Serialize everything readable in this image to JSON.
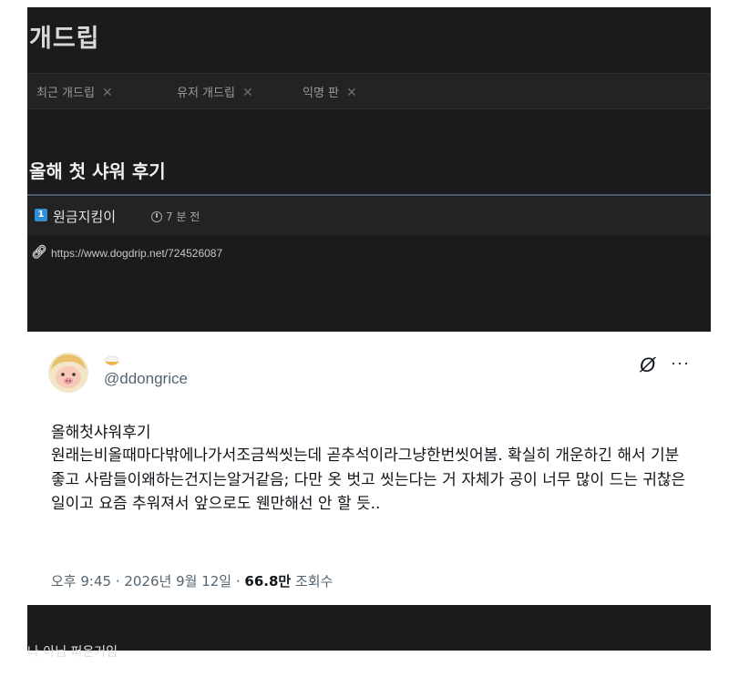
{
  "header": {
    "site_title": "개드립"
  },
  "tabs": [
    {
      "label": "최근  개드립",
      "close": "✕"
    },
    {
      "label": "유저 개드립",
      "close": "✕"
    },
    {
      "label": "익명 판",
      "close": "✕"
    }
  ],
  "post": {
    "title": "올해 첫 샤워 후기",
    "level_badge": "1",
    "author": "원금지킴이",
    "time": "7 분 전",
    "link": "https://www.dogdrip.net/724526087"
  },
  "tweet": {
    "handle": "@ddongrice",
    "logo": "Ø",
    "more": "···",
    "title": "올해첫샤워후기",
    "body": "원래는비올때마다밖에나가서조금씩씻는데 곧추석이라그냥한번씻어봄. 확실히 개운하긴 해서 기분 좋고 사람들이왜하는건지는알거같음; 다만 옷 벗고 씻는다는 거 자체가 공이 너무 많이 드는 귀찮은 일이고 요즘 추워져서 앞으로도 웬만해선 안 할 듯..",
    "time": "오후 9:45 · 2026년 9월 12일 · ",
    "views": "66.8만",
    "views_label": " 조회수"
  },
  "footer": {
    "text": "나 아님 퍼온거임"
  }
}
